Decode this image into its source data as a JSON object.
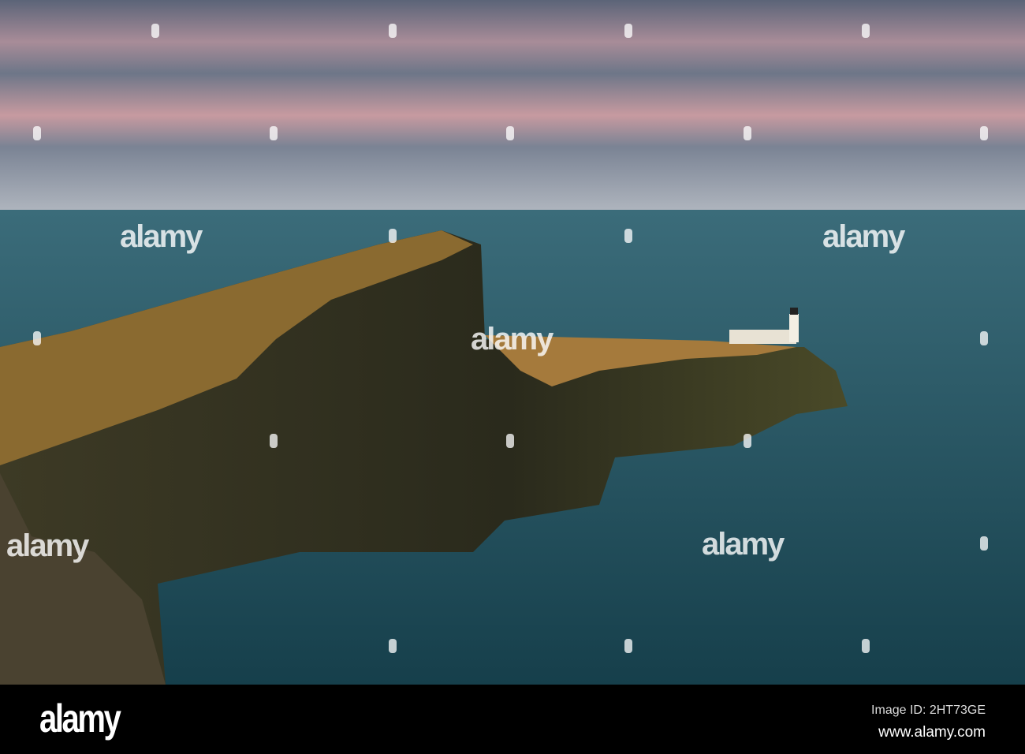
{
  "watermark": {
    "brand": "alamy"
  },
  "footer": {
    "logo": "alamy",
    "image_id": "Image ID: 2HT73GE",
    "url": "www.alamy.com"
  }
}
